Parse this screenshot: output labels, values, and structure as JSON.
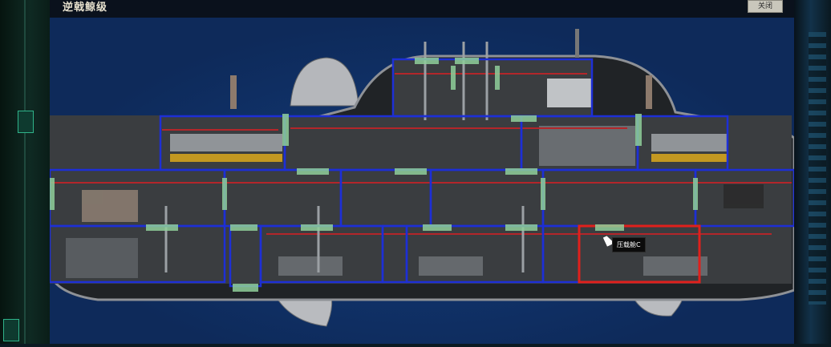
{
  "window": {
    "title": "逆戟鲸级",
    "close_label": "关闭"
  },
  "ship": {
    "hovered_room_label": "压载舱C",
    "colors": {
      "room_outline": "#1d2fd6",
      "selected_outline": "#e0201c",
      "door": "#8fcf9a",
      "hull": "#202326",
      "background": "#0e2a5a"
    }
  }
}
